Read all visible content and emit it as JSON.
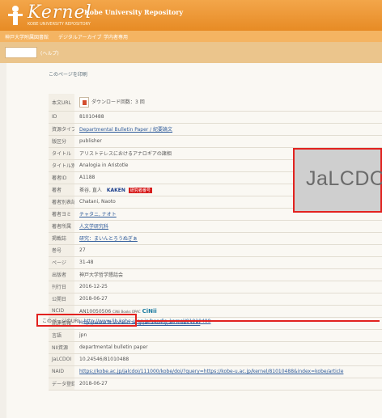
{
  "header": {
    "logo_text": "Kernel",
    "repo_title": "Kobe University Repository",
    "logo_sub": "KOBE UNIVERSITY REPOSITORY"
  },
  "nav": {
    "items": [
      "神戸大学附属図書館",
      "デジタルアーカイブ",
      "学内者専用"
    ]
  },
  "search": {
    "placeholder": "",
    "help": "(ヘルプ)"
  },
  "page": {
    "print_label": "このページを印刷"
  },
  "metadata": {
    "rows": [
      {
        "label": "本文URL",
        "value": "ダウンロード回数：3 回",
        "kind": "download"
      },
      {
        "label": "ID",
        "value": "81010488",
        "kind": "plain"
      },
      {
        "label": "資源タイプ",
        "value": "Departmental Bulletin Paper / 紀要論文",
        "kind": "link"
      },
      {
        "label": "版区分",
        "value": "publisher",
        "kind": "plain"
      },
      {
        "label": "タイトル",
        "value": "アリストテレスにおけるアナロギアの諸相",
        "kind": "plain"
      },
      {
        "label": "タイトル別表記",
        "value": "Analogia in Aristotle",
        "kind": "plain"
      },
      {
        "label": "著者ID",
        "value": "A1188",
        "kind": "plain"
      },
      {
        "label": "著者",
        "value": "茶谷, 直人",
        "kind": "author",
        "badge_kaken": "KAKEN",
        "badge_red": "研究者番号"
      },
      {
        "label": "著者別表記",
        "value": "Chatani, Naoto",
        "kind": "plain"
      },
      {
        "label": "著者ヨミ",
        "value": "チャタニ, ナオト",
        "kind": "link"
      },
      {
        "label": "著者所属",
        "value": "人文学研究科",
        "kind": "link"
      },
      {
        "label": "掲載誌",
        "value": "研究：まいんとろうぬぎぁ",
        "kind": "link"
      },
      {
        "label": "巻号",
        "value": "27",
        "kind": "plain"
      },
      {
        "label": "ページ",
        "value": "31-48",
        "kind": "plain"
      },
      {
        "label": "出版者",
        "value": "神戸大学哲学懇話会",
        "kind": "plain"
      },
      {
        "label": "刊行日",
        "value": "2016-12-25",
        "kind": "plain"
      },
      {
        "label": "公開日",
        "value": "2018-06-27",
        "kind": "plain"
      },
      {
        "label": "NCID",
        "value": "AN10050506",
        "kind": "ncid",
        "cinii_small": "CiNii Books OPAC",
        "cinii_logo": "CiNii"
      },
      {
        "label": "関連情報",
        "value": "http://www.lit.kobe-u.ac.jp/academy/archives.htm",
        "kind": "link"
      },
      {
        "label": "言語",
        "value": "jpn",
        "kind": "plain"
      },
      {
        "label": "NII資源",
        "value": "departmental bulletin paper",
        "kind": "plain"
      },
      {
        "label": "JaLCDOI",
        "value": "10.24546/81010488",
        "kind": "plain"
      },
      {
        "label": "NAID",
        "value": "https://kobe.ac.jp/jalcdoi/111000/kobe/doi/?query=https://kobe-u.ac.jp/kernel/81010488&index=kobe/article",
        "kind": "link"
      },
      {
        "label": "データ登録日",
        "value": "2018-06-27",
        "kind": "plain"
      }
    ]
  },
  "permalink": {
    "label": "このページのURL:",
    "url": "http://www.lib.kobe-u.ac.jp/handle_kernel/81010488"
  },
  "zoom": {
    "text": "JaLCDOI"
  }
}
